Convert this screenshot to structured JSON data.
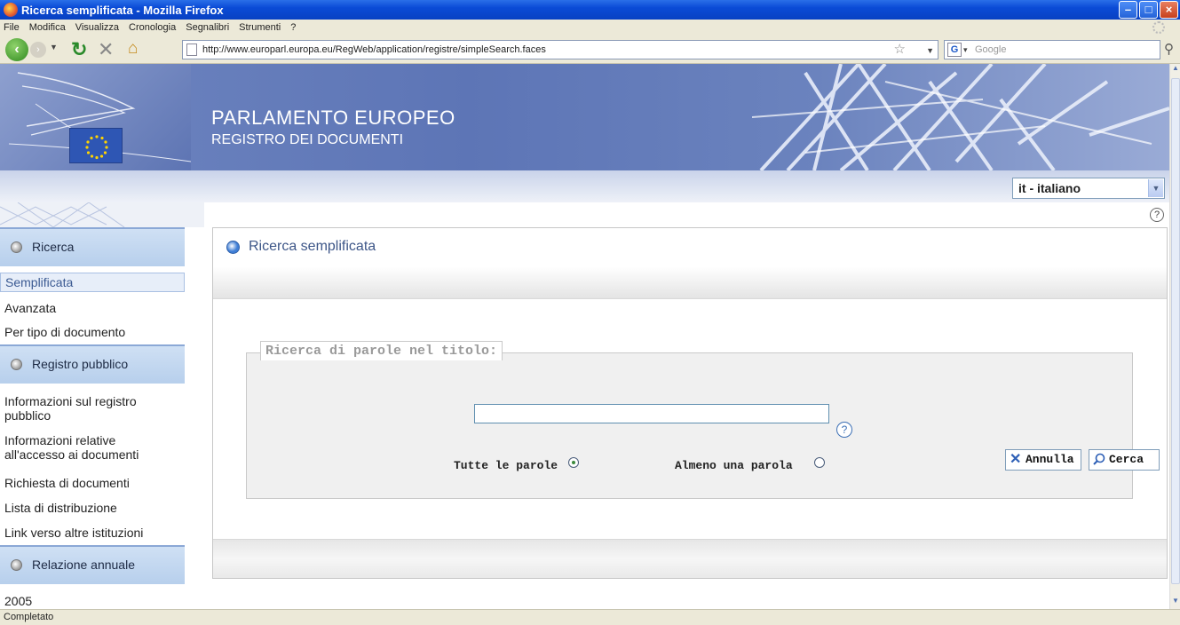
{
  "window": {
    "title": "Ricerca semplificata - Mozilla Firefox"
  },
  "menu": [
    "File",
    "Modifica",
    "Visualizza",
    "Cronologia",
    "Segnalibri",
    "Strumenti",
    "?"
  ],
  "nav": {
    "url": "http://www.europarl.europa.eu/RegWeb/application/registre/simpleSearch.faces",
    "search_placeholder": "Google"
  },
  "banner": {
    "title": "PARLAMENTO EUROPEO",
    "subtitle": "REGISTRO DEI DOCUMENTI"
  },
  "language": {
    "selected": "it - italiano"
  },
  "sidebar": {
    "sections": [
      {
        "label": "Ricerca",
        "items": [
          "Semplificata",
          "Avanzata",
          "Per tipo di documento"
        ]
      },
      {
        "label": "Registro pubblico",
        "items": [
          "Informazioni sul registro pubblico",
          "Informazioni relative all'accesso ai documenti",
          "Richiesta di documenti",
          "Lista di distribuzione",
          "Link verso altre istituzioni"
        ]
      },
      {
        "label": "Relazione annuale",
        "items": [
          "2005"
        ]
      }
    ],
    "active_item": "Semplificata"
  },
  "main": {
    "title": "Ricerca semplificata",
    "fieldset_legend": "Ricerca di parole nel titolo:",
    "title_input_value": "",
    "radio_all_label": "Tutte le parole",
    "radio_any_label": "Almeno una parola",
    "radio_selected": "all",
    "cancel_label": "Annulla",
    "search_label": "Cerca"
  },
  "status": {
    "text": "Completato"
  },
  "colors": {
    "banner_blue": "#5d75b6",
    "titlebar_blue": "#0a4bd6",
    "panel_title": "#3d5688"
  },
  "icons": [
    "firefox-icon",
    "back-icon",
    "forward-icon",
    "reload-icon",
    "stop-icon",
    "home-icon",
    "bookmark-star-icon",
    "google-icon",
    "search-icon",
    "help-icon",
    "bullet-icon",
    "close-x-icon"
  ]
}
